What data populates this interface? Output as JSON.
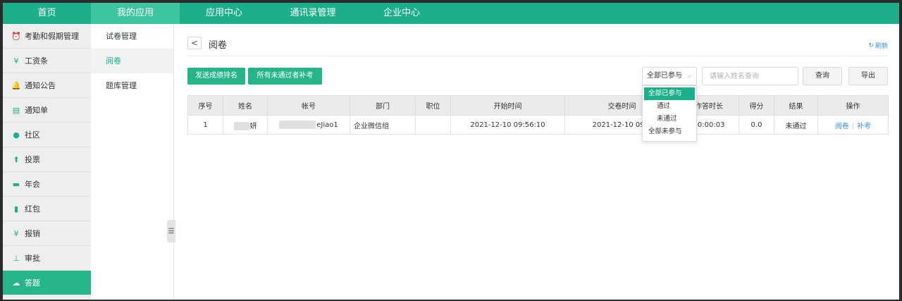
{
  "nav": {
    "items": [
      {
        "label": "首页",
        "active": false
      },
      {
        "label": "我的应用",
        "active": true
      },
      {
        "label": "应用中心",
        "active": false
      },
      {
        "label": "通讯录管理",
        "active": false
      },
      {
        "label": "企业中心",
        "active": false
      }
    ]
  },
  "sidebar": {
    "items": [
      {
        "label": "考勤和假期管理",
        "icon": "attendance-icon",
        "glyph": "⏰"
      },
      {
        "label": "工资条",
        "icon": "salary-icon",
        "glyph": "¥"
      },
      {
        "label": "通知公告",
        "icon": "bell-icon",
        "glyph": "🔔"
      },
      {
        "label": "通知单",
        "icon": "list-icon",
        "glyph": "▤"
      },
      {
        "label": "社区",
        "icon": "chat-icon",
        "glyph": "●"
      },
      {
        "label": "投票",
        "icon": "vote-icon",
        "glyph": "⬆"
      },
      {
        "label": "年会",
        "icon": "card-icon",
        "glyph": "▬"
      },
      {
        "label": "红包",
        "icon": "redpacket-icon",
        "glyph": "▮"
      },
      {
        "label": "报销",
        "icon": "yen-icon",
        "glyph": "¥"
      },
      {
        "label": "审批",
        "icon": "stamp-icon",
        "glyph": "⊥"
      },
      {
        "label": "答题",
        "icon": "cloud-icon",
        "glyph": "☁",
        "active": true
      }
    ]
  },
  "submenu": {
    "items": [
      {
        "label": "试卷管理",
        "active": false
      },
      {
        "label": "阅卷",
        "active": true
      },
      {
        "label": "题库管理",
        "active": false
      }
    ]
  },
  "page": {
    "title": "阅卷",
    "back_label": "<",
    "refresh_label": "刷新"
  },
  "toolbar": {
    "send_rank_label": "发送成绩排名",
    "makeup_label": "所有未通过者补考",
    "filter_value": "全部已参与",
    "search_placeholder": "请输入姓名查询",
    "query_label": "查询",
    "export_label": "导出"
  },
  "filter_options": [
    "全部已参与",
    "通过",
    "未通过",
    "全部未参与"
  ],
  "table": {
    "headers": [
      "序号",
      "姓名",
      "帐号",
      "部门",
      "职位",
      "开始时间",
      "交卷时间",
      "作答时长",
      "得分",
      "结果",
      "操作"
    ],
    "rows": [
      {
        "index": "1",
        "name": "妍",
        "account": "eJiao1",
        "department": "企业微信组",
        "position": "",
        "start_time": "2021-12-10 09:56:10",
        "submit_time": "2021-12-10 09:5",
        "duration": "00:00:03",
        "score": "0.0",
        "result": "未通过",
        "action_review": "阅卷",
        "action_makeup": "补考"
      }
    ]
  },
  "colors": {
    "brand": "#1caf8a",
    "link": "#3a8ee6"
  }
}
